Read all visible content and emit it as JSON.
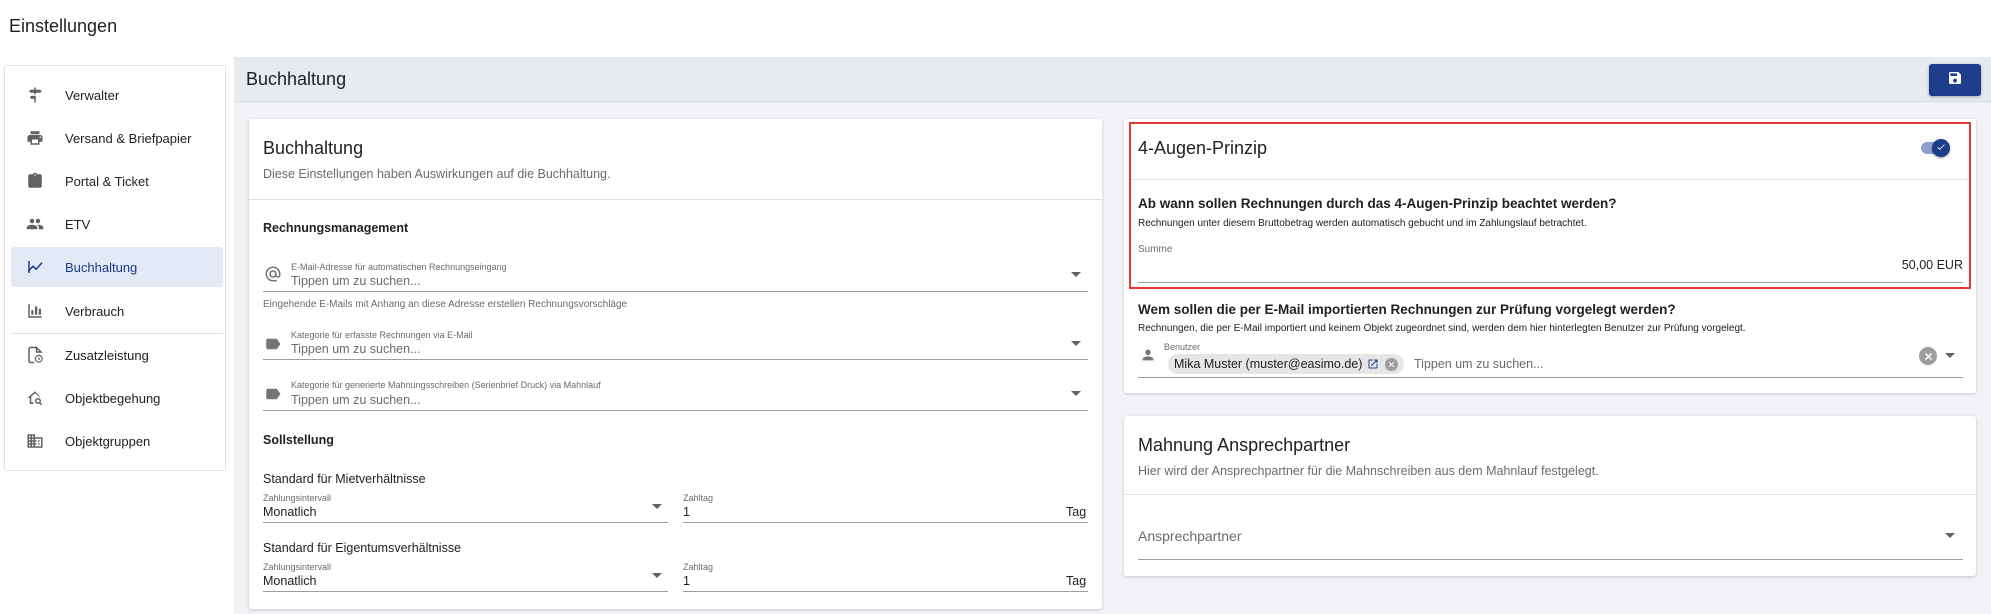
{
  "app": {
    "title": "Einstellungen"
  },
  "sidebar": {
    "items": [
      {
        "label": "Verwalter",
        "icon": "signpost-icon"
      },
      {
        "label": "Versand & Briefpapier",
        "icon": "printer-icon"
      },
      {
        "label": "Portal & Ticket",
        "icon": "clipboard-icon"
      },
      {
        "label": "ETV",
        "icon": "people-icon"
      },
      {
        "label": "Buchhaltung",
        "icon": "chart-line-icon",
        "active": true
      },
      {
        "label": "Verbrauch",
        "icon": "bar-chart-icon"
      },
      {
        "label": "Zusatzleistung",
        "icon": "document-clock-icon"
      },
      {
        "label": "Objektbegehung",
        "icon": "house-search-icon"
      },
      {
        "label": "Objektgruppen",
        "icon": "building-icon"
      }
    ]
  },
  "main": {
    "title": "Buchhaltung",
    "save_icon": "floppy-disk-icon"
  },
  "left_card": {
    "title": "Buchhaltung",
    "subtitle": "Diese Einstellungen haben Auswirkungen auf die Buchhaltung.",
    "rechnungsmanagement": {
      "heading": "Rechnungsmanagement",
      "email_field": {
        "label": "E-Mail-Adresse für automatischen Rechnungseingang",
        "placeholder": "Tippen um zu suchen...",
        "hint": "Eingehende E-Mails mit Anhang an diese Adresse erstellen Rechnungsvorschläge"
      },
      "category_email": {
        "label": "Kategorie für erfasste Rechnungen via E-Mail",
        "placeholder": "Tippen um zu suchen..."
      },
      "category_mahnung": {
        "label": "Kategorie für generierte Mahnungsschreiben (Serienbrief Druck) via Mahnlauf",
        "placeholder": "Tippen um zu suchen..."
      }
    },
    "sollstellung": {
      "heading": "Sollstellung",
      "miet": {
        "title": "Standard für Mietverhältnisse",
        "interval_label": "Zahlungsintervall",
        "interval_value": "Monatlich",
        "day_label": "Zahltag",
        "day_value": "1",
        "day_unit": "Tag"
      },
      "eigentum": {
        "title": "Standard für Eigentumsverhältnisse",
        "interval_label": "Zahlungsintervall",
        "interval_value": "Monatlich",
        "day_label": "Zahltag",
        "day_value": "1",
        "day_unit": "Tag"
      }
    }
  },
  "right_card": {
    "title": "4-Augen-Prinzip",
    "toggle_on": true,
    "q1": {
      "heading": "Ab wann sollen Rechnungen durch das 4-Augen-Prinzip beachtet werden?",
      "desc": "Rechnungen unter diesem Bruttobetrag werden automatisch gebucht und im Zahlungslauf betrachtet.",
      "sum_label": "Summe",
      "sum_value": "50,00 EUR"
    },
    "q2": {
      "heading": "Wem sollen die per E-Mail importierten Rechnungen zur Prüfung vorgelegt werden?",
      "desc": "Rechnungen, die per E-Mail importiert und keinem Objekt zugeordnet sind, werden dem hier hinterlegten Benutzer zur Prüfung vorgelegt.",
      "user_label": "Benutzer",
      "chip_text": "Mika Muster (muster@easimo.de)",
      "placeholder": "Tippen um zu suchen..."
    }
  },
  "mahnung_card": {
    "title": "Mahnung Ansprechpartner",
    "subtitle": "Hier wird der Ansprechpartner für die Mahnschreiben aus dem Mahnlauf festgelegt.",
    "field_placeholder": "Ansprechpartner"
  },
  "colors": {
    "accent": "#1e3e8c",
    "active_bg": "#e3eaf5",
    "highlight_border": "#e53935"
  }
}
